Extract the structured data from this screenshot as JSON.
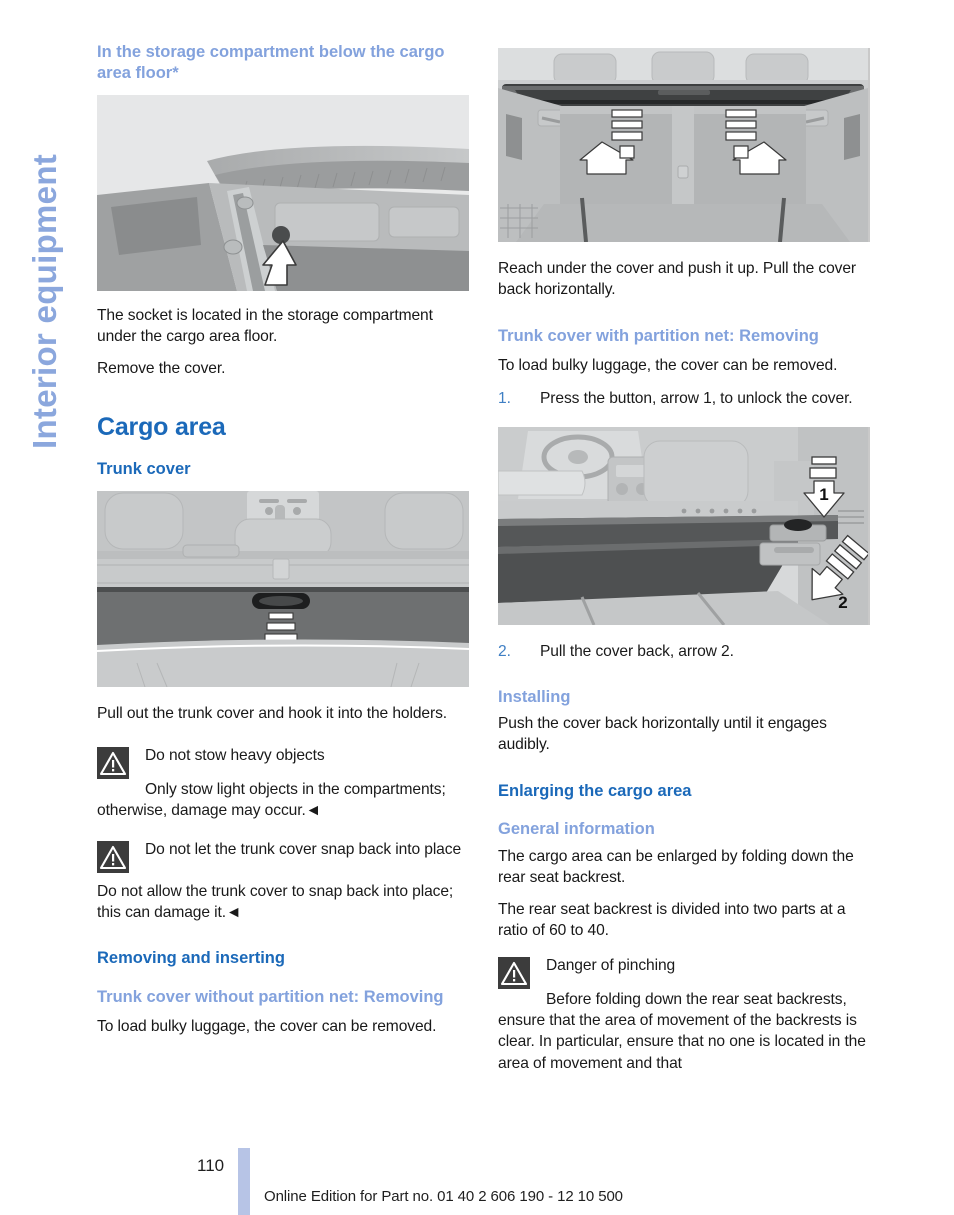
{
  "side_tab": {
    "label": "Interior equipment",
    "color": "#8ba7dd"
  },
  "colors": {
    "heading_dark_blue": "#1b69b9",
    "heading_light_blue": "#83a2dd",
    "list_number_blue": "#3f7fc4",
    "warning_icon_bg": "#3c3c3c",
    "footer_bar": "#b7c4e6"
  },
  "left_column": {
    "heading_storage": "In the storage compartment below the cargo area floor*",
    "figure_storage_caption": "storage-compartment-socket-illustration",
    "para_socket": "The socket is located in the storage compartment under the cargo area floor.",
    "para_remove_cover": "Remove the cover.",
    "heading_cargo_area": "Cargo area",
    "heading_trunk_cover": "Trunk cover",
    "figure_trunk_caption": "trunk-cover-pull-down-illustration",
    "para_pull_out": "Pull out the trunk cover and hook it into the holders.",
    "warning_heavy_objects": {
      "icon": "warning-triangle-icon",
      "title": "Do not stow heavy objects",
      "body": "Only stow light objects in the compartments; otherwise, damage may occur.◄"
    },
    "warning_snap_back": {
      "icon": "warning-triangle-icon",
      "title": "Do not let the trunk cover snap back into place",
      "body": "Do not allow the trunk cover to snap back into place; this can damage it.◄"
    },
    "heading_removing_inserting": "Removing and inserting",
    "heading_without_net": "Trunk cover without partition net: Removing",
    "para_bulky_luggage": "To load bulky luggage, the cover can be removed."
  },
  "right_column": {
    "figure_cargo_caption": "cargo-area-cover-push-up-illustration",
    "para_reach_under": "Reach under the cover and push it up. Pull the cover back horizontally.",
    "heading_with_net": "Trunk cover with partition net: Removing",
    "para_bulky_luggage": "To load bulky luggage, the cover can be removed.",
    "steps_removing": [
      {
        "num": "1.",
        "text": "Press the button, arrow 1, to unlock the cover."
      }
    ],
    "figure_numbered_caption": "trunk-cover-arrows-1-2-illustration",
    "steps_removing_2": [
      {
        "num": "2.",
        "text": "Pull the cover back, arrow 2."
      }
    ],
    "heading_installing": "Installing",
    "para_installing": "Push the cover back horizontally until it engages audibly.",
    "heading_enlarging": "Enlarging the cargo area",
    "heading_general_info": "General information",
    "para_enlarged": "The cargo area can be enlarged by folding down the rear seat backrest.",
    "para_ratio": "The rear seat backrest is divided into two parts at a ratio of 60 to 40.",
    "warning_pinching": {
      "icon": "warning-triangle-icon",
      "title": "Danger of pinching",
      "body": "Before folding down the rear seat backrests, ensure that the area of movement of the backrests is clear. In particular, ensure that no one is located in the area of movement and that"
    }
  },
  "footer": {
    "page_number": "110",
    "edition_note": "Online Edition for Part no. 01 40 2 606 190 - 12 10 500"
  }
}
